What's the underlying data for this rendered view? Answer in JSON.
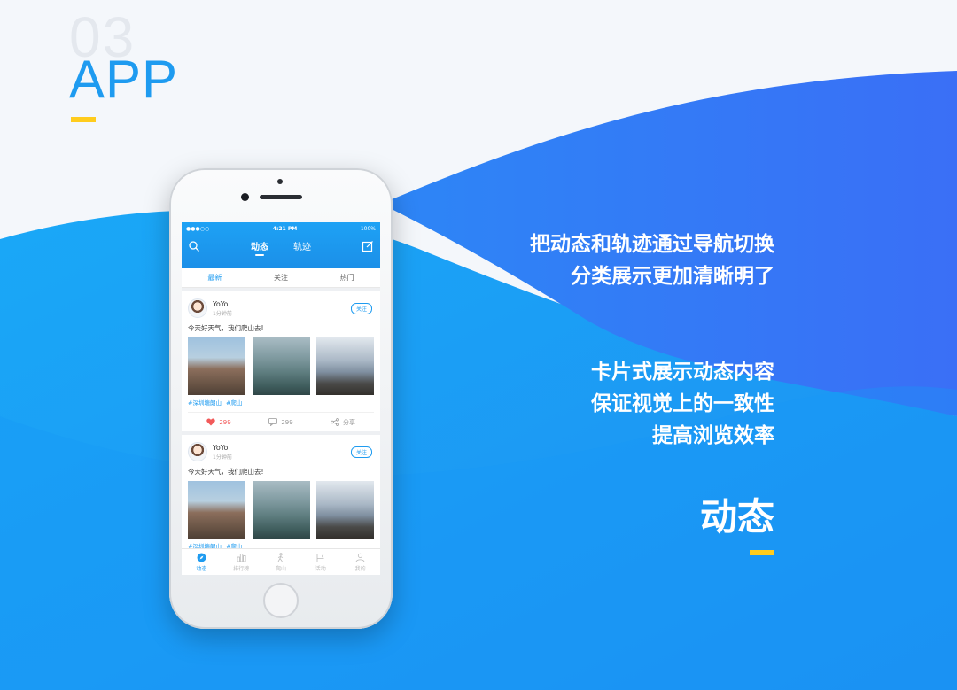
{
  "section": {
    "number": "03",
    "title": "APP"
  },
  "features": {
    "paragraph1": [
      "把动态和轨迹通过导航切换",
      "分类展示更加清晰明了"
    ],
    "paragraph2": [
      "卡片式展示动态内容",
      "保证视觉上的一致性",
      "提高浏览效率"
    ],
    "title": "动态"
  },
  "colors": {
    "accent": "#1e9bf0",
    "yellow": "#ffcc1d",
    "wave_dark": "#2f7bf7",
    "wave_light": "#1aa3f7"
  },
  "phone": {
    "status": {
      "carrier": "●●●○○",
      "time": "4:21 PM",
      "battery": "100%"
    },
    "nav": {
      "tab1": "动态",
      "tab2": "轨迹",
      "left_icon": "search-icon",
      "right_icon": "edit-icon"
    },
    "subtabs": [
      "最新",
      "关注",
      "热门"
    ],
    "posts": [
      {
        "user": "YoYo",
        "time": "1分钟前",
        "follow": "关注",
        "text": "今天好天气，我们爬山去!",
        "tags": [
          "#深圳塘朗山",
          "#爬山"
        ],
        "likes": "299",
        "comments": "299",
        "share": "分享"
      },
      {
        "user": "YoYo",
        "time": "1分钟前",
        "follow": "关注",
        "text": "今天好天气，我们爬山去!",
        "tags": [
          "#深圳塘朗山",
          "#爬山"
        ]
      }
    ],
    "tabbar": [
      "动态",
      "排行榜",
      "爬山",
      "活动",
      "我的"
    ]
  }
}
